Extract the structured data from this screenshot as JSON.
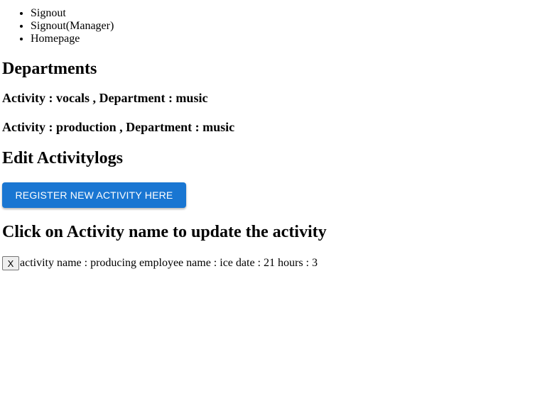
{
  "nav": {
    "items": [
      {
        "label": "Signout"
      },
      {
        "label": "Signout(Manager)"
      },
      {
        "label": "Homepage"
      }
    ]
  },
  "departments": {
    "heading": "Departments",
    "entries": [
      {
        "text": "Activity : vocals , Department : music"
      },
      {
        "text": "Activity : production , Department : music"
      }
    ]
  },
  "edit": {
    "heading": "Edit Activitylogs",
    "register_button": "REGISTER NEW ACTIVITY HERE"
  },
  "logs": {
    "heading": "Click on Activity name to update the activity",
    "delete_label": "X",
    "rows": [
      {
        "text": "activity name : producing employee name : ice date : 21 hours : 3"
      }
    ]
  }
}
